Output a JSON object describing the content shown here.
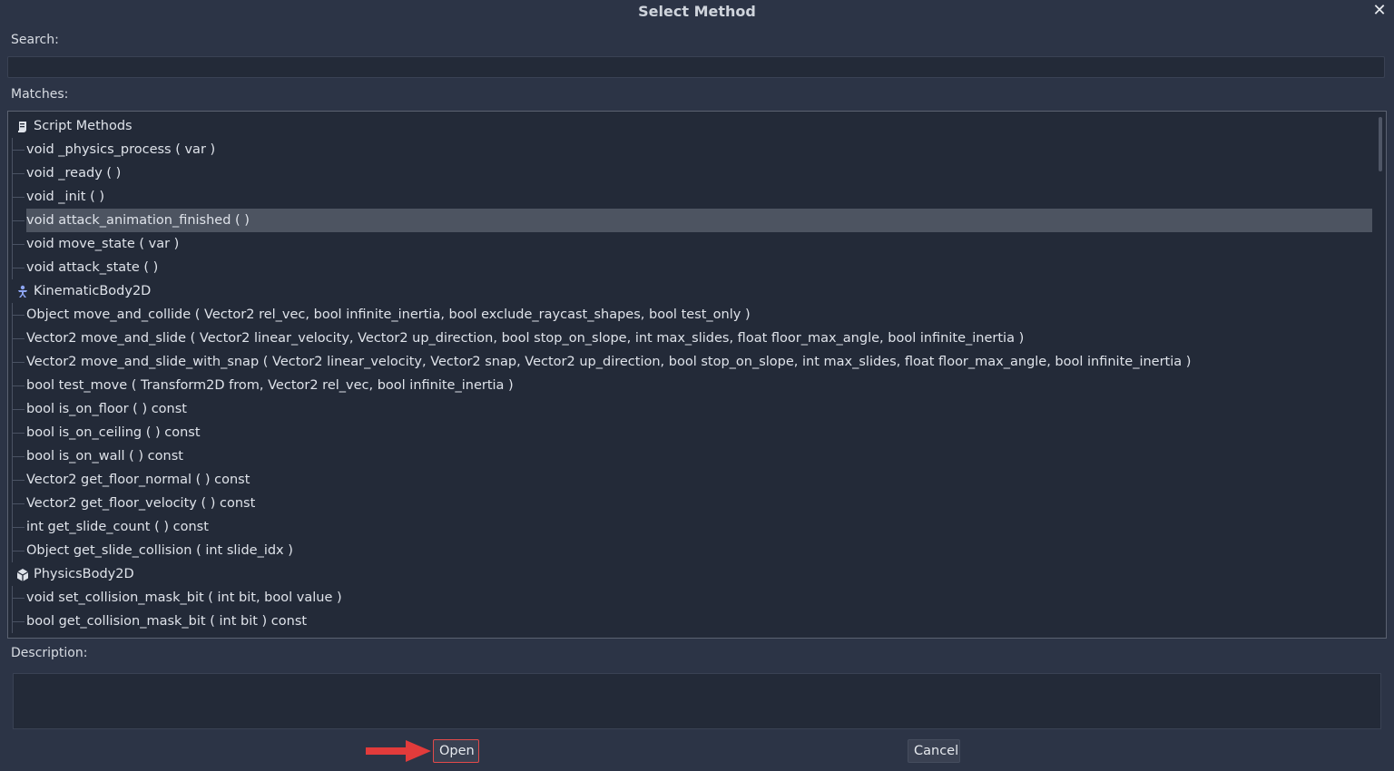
{
  "dialog": {
    "title": "Select Method",
    "close_glyph": "✕",
    "search_label": "Search:",
    "search_value": "",
    "matches_label": "Matches:",
    "description_label": "Description:",
    "description_text": "",
    "open_label": "Open",
    "cancel_label": "Cancel"
  },
  "tree": {
    "rows": [
      {
        "kind": "category",
        "label": "Script Methods",
        "icon": "script-icon"
      },
      {
        "kind": "item",
        "label": "void  _physics_process ( var  )"
      },
      {
        "kind": "item",
        "label": "void  _ready (  )"
      },
      {
        "kind": "item",
        "label": "void  _init (  )"
      },
      {
        "kind": "item",
        "label": "void  attack_animation_finished (  )",
        "selected": true
      },
      {
        "kind": "item",
        "label": "void  move_state ( var  )"
      },
      {
        "kind": "item",
        "label": "void  attack_state (  )"
      },
      {
        "kind": "category",
        "label": "KinematicBody2D",
        "icon": "kinematic-body-icon"
      },
      {
        "kind": "item",
        "label": "Object move_and_collide ( Vector2 rel_vec, bool infinite_inertia, bool exclude_raycast_shapes, bool test_only )"
      },
      {
        "kind": "item",
        "label": "Vector2 move_and_slide ( Vector2 linear_velocity, Vector2 up_direction, bool stop_on_slope, int max_slides, float floor_max_angle, bool infinite_inertia )"
      },
      {
        "kind": "item",
        "label": "Vector2 move_and_slide_with_snap ( Vector2 linear_velocity, Vector2 snap, Vector2 up_direction, bool stop_on_slope, int max_slides, float floor_max_angle, bool infinite_inertia )"
      },
      {
        "kind": "item",
        "label": "bool test_move ( Transform2D from, Vector2 rel_vec, bool infinite_inertia )"
      },
      {
        "kind": "item",
        "label": "bool is_on_floor (  ) const"
      },
      {
        "kind": "item",
        "label": "bool is_on_ceiling (  ) const"
      },
      {
        "kind": "item",
        "label": "bool is_on_wall (  ) const"
      },
      {
        "kind": "item",
        "label": "Vector2 get_floor_normal (  ) const"
      },
      {
        "kind": "item",
        "label": "Vector2 get_floor_velocity (  ) const"
      },
      {
        "kind": "item",
        "label": "int get_slide_count (  ) const"
      },
      {
        "kind": "item",
        "label": "Object get_slide_collision ( int slide_idx )"
      },
      {
        "kind": "category",
        "label": "PhysicsBody2D",
        "icon": "physics-body-icon"
      },
      {
        "kind": "item",
        "label": "void  set_collision_mask_bit ( int bit, bool value )"
      },
      {
        "kind": "item",
        "label": "bool get_collision_mask_bit ( int bit ) const"
      }
    ]
  },
  "colors": {
    "background": "#2c3446",
    "panel": "#232a38",
    "selection": "#4d5461",
    "annotation_red": "#e23b3b",
    "category_icon": "#8da5f3"
  }
}
